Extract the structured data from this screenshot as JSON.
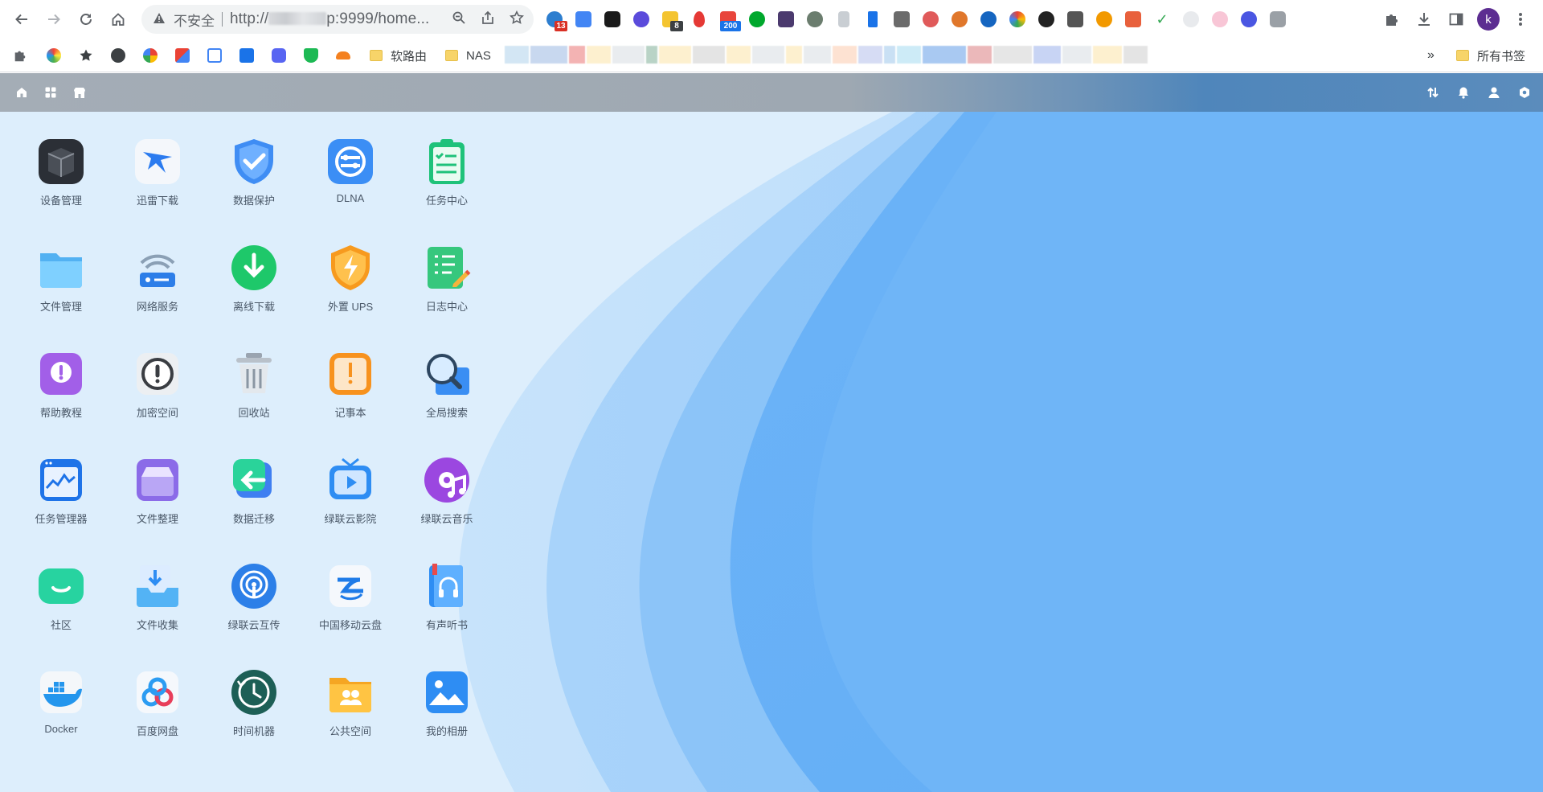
{
  "browser": {
    "nav": {
      "back": "back-icon",
      "forward": "forward-icon",
      "reload": "reload-icon",
      "home": "home-icon"
    },
    "omnibox": {
      "security_label": "不安全",
      "url_prefix": "http://",
      "url_suffix": "p:9999/home..."
    },
    "profile_initial": "k",
    "extension_badges": {
      "ext1": "13",
      "ext6": "8",
      "ext9": "200"
    },
    "bookmarks": {
      "router": "软路由",
      "nas": "NAS",
      "all": "所有书签"
    }
  },
  "nas": {
    "colors": {
      "bar_left": "#a4adb6",
      "bar_right": "#5b8cbc",
      "desktop_bg": "#ddeefc",
      "wave_main": "#6fb5f7"
    },
    "apps": [
      {
        "id": "device",
        "label": "设备管理"
      },
      {
        "id": "xunlei",
        "label": "迅雷下载"
      },
      {
        "id": "protect",
        "label": "数据保护"
      },
      {
        "id": "dlna",
        "label": "DLNA",
        "icon_text": ""
      },
      {
        "id": "task",
        "label": "任务中心"
      },
      {
        "id": "files",
        "label": "文件管理"
      },
      {
        "id": "network",
        "label": "网络服务"
      },
      {
        "id": "offline",
        "label": "离线下载"
      },
      {
        "id": "ups",
        "label": "外置 UPS"
      },
      {
        "id": "log",
        "label": "日志中心"
      },
      {
        "id": "help",
        "label": "帮助教程",
        "icon_text": "!"
      },
      {
        "id": "encrypt",
        "label": "加密空间",
        "icon_text": "!"
      },
      {
        "id": "trash",
        "label": "回收站"
      },
      {
        "id": "notes",
        "label": "记事本",
        "icon_text": "!"
      },
      {
        "id": "search",
        "label": "全局搜索"
      },
      {
        "id": "taskmgr",
        "label": "任务管理器"
      },
      {
        "id": "organize",
        "label": "文件整理"
      },
      {
        "id": "migrate",
        "label": "数据迁移"
      },
      {
        "id": "cinema",
        "label": "绿联云影院"
      },
      {
        "id": "music",
        "label": "绿联云音乐"
      },
      {
        "id": "community",
        "label": "社区"
      },
      {
        "id": "collect",
        "label": "文件收集"
      },
      {
        "id": "airdrop",
        "label": "绿联云互传"
      },
      {
        "id": "cmcloud",
        "label": "中国移动云盘"
      },
      {
        "id": "audiobook",
        "label": "有声听书"
      },
      {
        "id": "docker",
        "label": "Docker"
      },
      {
        "id": "baidu",
        "label": "百度网盘"
      },
      {
        "id": "timemachine",
        "label": "时间机器"
      },
      {
        "id": "public",
        "label": "公共空间"
      },
      {
        "id": "album",
        "label": "我的相册"
      }
    ]
  }
}
